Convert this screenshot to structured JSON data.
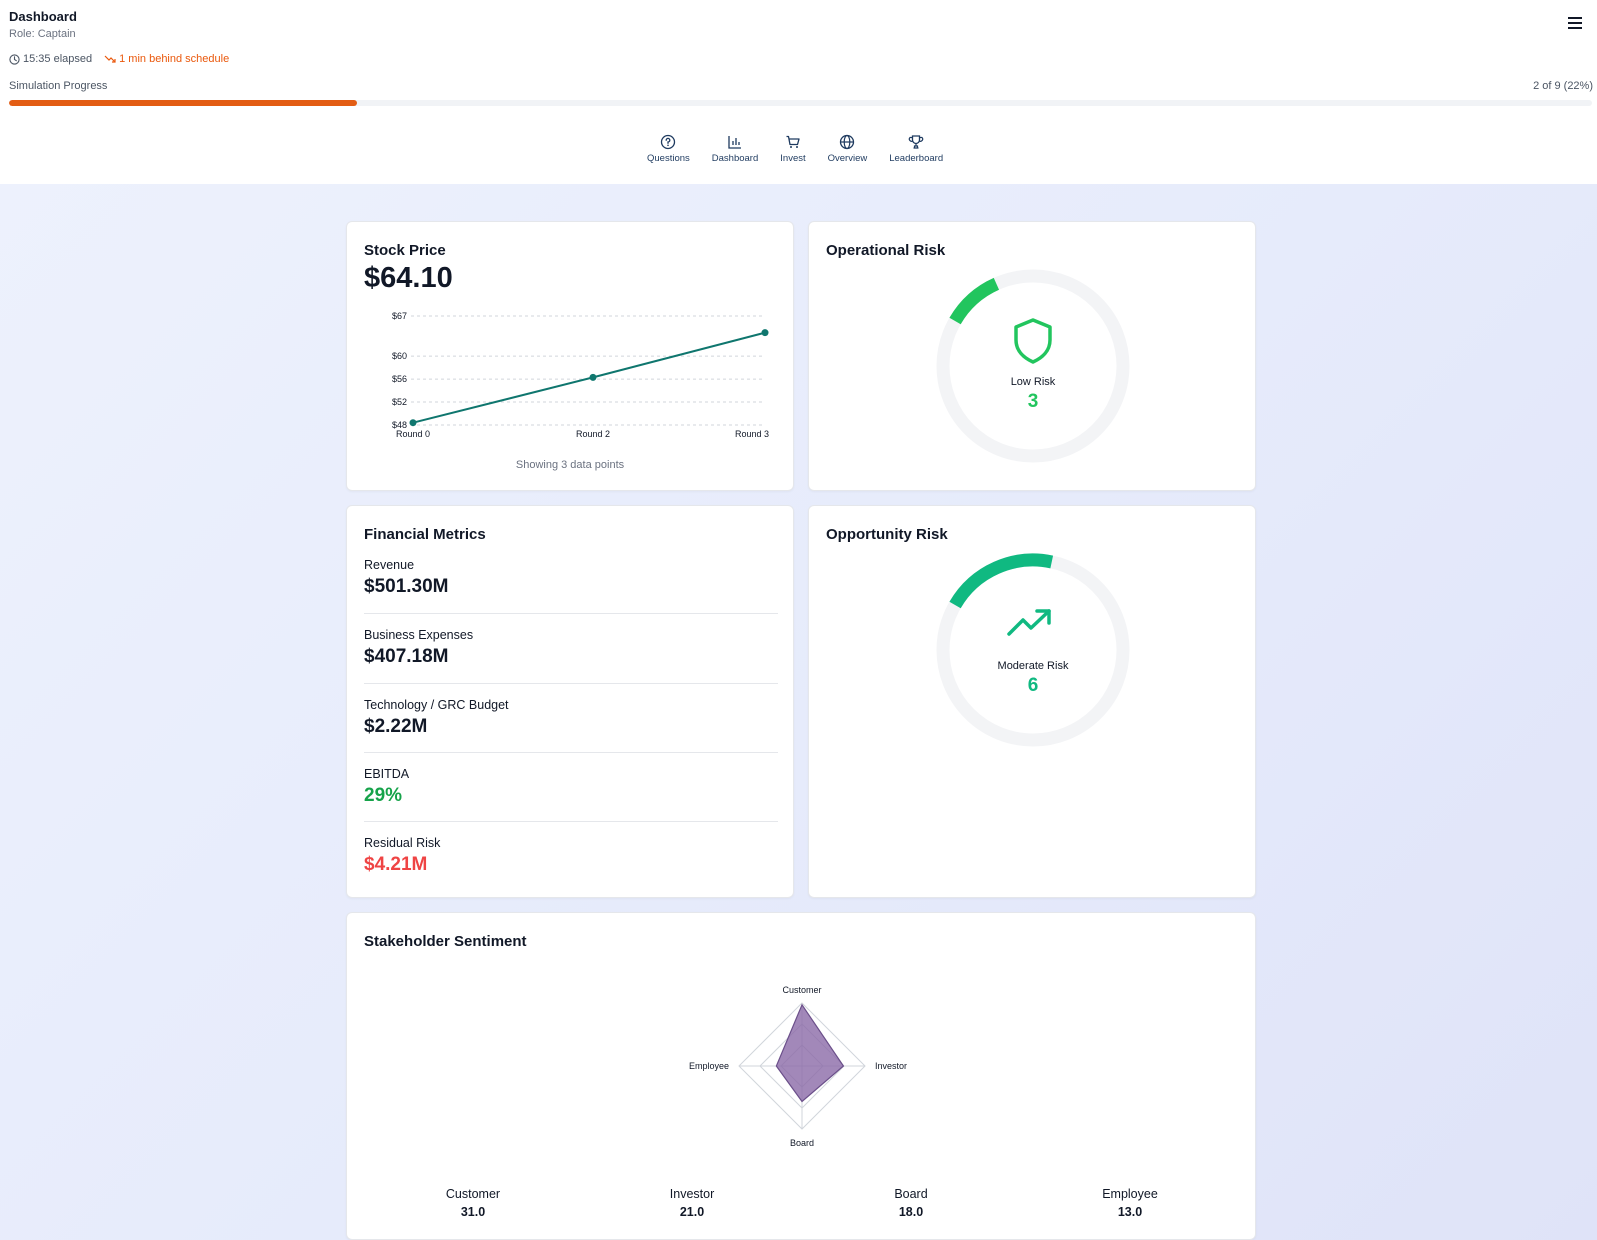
{
  "header": {
    "title": "Dashboard",
    "role": "Role: Captain",
    "elapsed": "15:35 elapsed",
    "schedule_status": "1 min behind schedule",
    "menu_icon": "hamburger-menu-icon"
  },
  "progress": {
    "label": "Simulation Progress",
    "count": "2 of 9 (22%)",
    "percent": 22,
    "fill_color": "#e35d14"
  },
  "nav": {
    "items": [
      {
        "label": "Questions",
        "icon": "help-circle-icon"
      },
      {
        "label": "Dashboard",
        "icon": "bar-chart-icon"
      },
      {
        "label": "Invest",
        "icon": "cart-icon"
      },
      {
        "label": "Overview",
        "icon": "globe-icon"
      },
      {
        "label": "Leaderboard",
        "icon": "trophy-icon"
      }
    ]
  },
  "stock": {
    "title": "Stock Price",
    "value": "$64.10",
    "footer": "Showing 3 data points"
  },
  "chart_data": {
    "type": "line",
    "x": [
      "Round 0",
      "Round 2",
      "Round 3"
    ],
    "series": [
      {
        "values": [
          48.4,
          56.3,
          64.1
        ]
      }
    ],
    "yticks": [
      "$67",
      "$60",
      "$56",
      "$52",
      "$48"
    ],
    "ytick_values": [
      67,
      60,
      56,
      52,
      48
    ],
    "ylim": [
      48,
      67
    ],
    "grid": true,
    "color": "#0f766e"
  },
  "operational_risk": {
    "title": "Operational Risk",
    "label": "Low Risk",
    "value": "3",
    "level": 0.1,
    "icon": "shield-icon",
    "color": "#22c55e"
  },
  "opportunity_risk": {
    "title": "Opportunity Risk",
    "label": "Moderate Risk",
    "value": "6",
    "level": 0.2,
    "icon": "trending-up-icon",
    "color": "#10b981"
  },
  "financial": {
    "title": "Financial Metrics",
    "metrics": [
      {
        "label": "Revenue",
        "value": "$501.30M",
        "color": "#111827"
      },
      {
        "label": "Business Expenses",
        "value": "$407.18M",
        "color": "#111827"
      },
      {
        "label": "Technology / GRC Budget",
        "value": "$2.22M",
        "color": "#111827"
      },
      {
        "label": "EBITDA",
        "value": "29%",
        "color": "#16a34a"
      },
      {
        "label": "Residual Risk",
        "value": "$4.21M",
        "color": "#ef4444"
      }
    ]
  },
  "sentiment": {
    "title": "Stakeholder Sentiment",
    "axes": [
      "Customer",
      "Investor",
      "Board",
      "Employee"
    ],
    "values": [
      31.0,
      21.0,
      18.0,
      13.0
    ],
    "stats": [
      {
        "name": "Customer",
        "value": "31.0"
      },
      {
        "name": "Investor",
        "value": "21.0"
      },
      {
        "name": "Board",
        "value": "18.0"
      },
      {
        "name": "Employee",
        "value": "13.0"
      }
    ],
    "fill_color": "#8b6aa8"
  }
}
